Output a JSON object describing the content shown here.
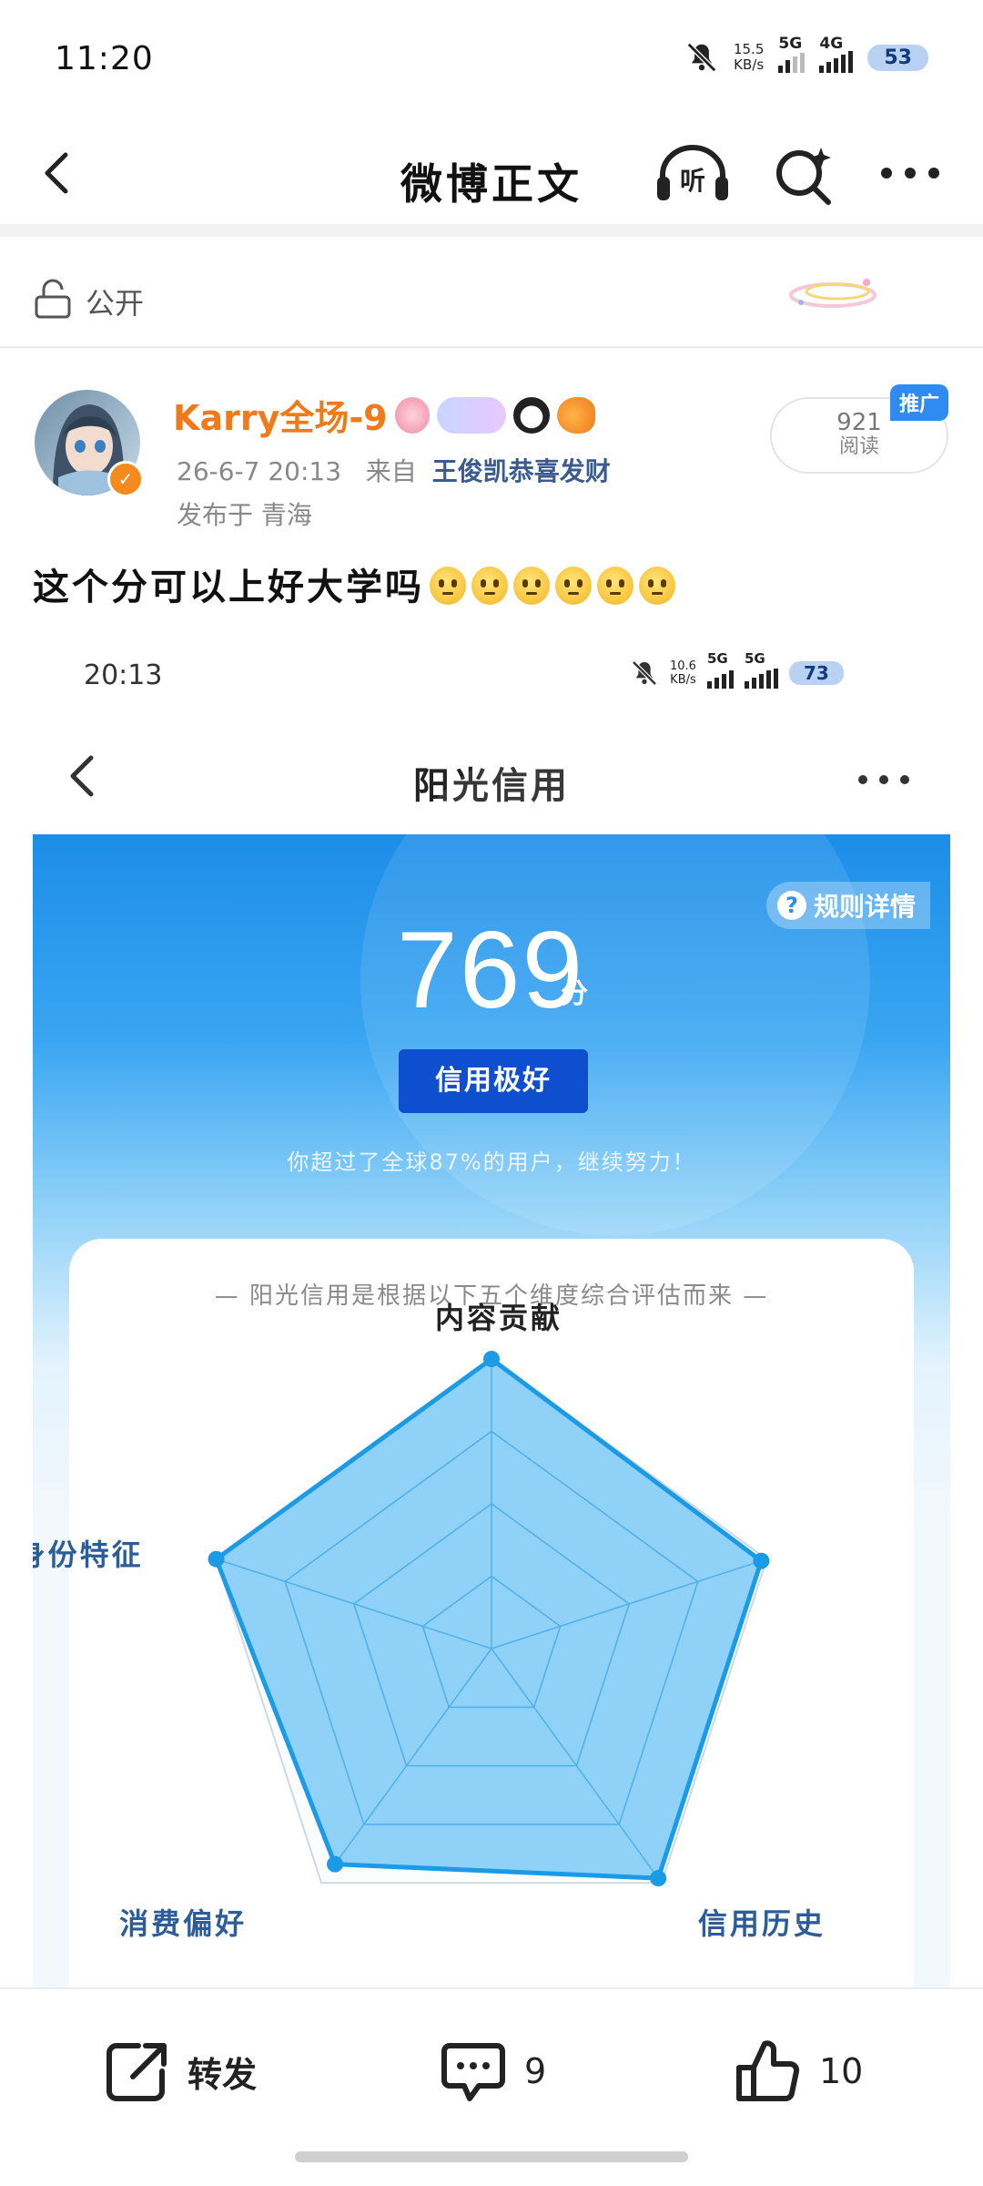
{
  "status_bar": {
    "time": "11:20",
    "net_speed": "15.5",
    "net_unit": "KB/s",
    "sim1": "5G",
    "sim2": "4G",
    "battery": "53"
  },
  "nav": {
    "title": "微博正文",
    "listen_label": "听",
    "back_icon": "chevron-left-icon",
    "search_icon": "ai-search-icon",
    "more_icon": "more-dots-icon"
  },
  "visibility": {
    "label": "公开",
    "icon": "unlock-icon"
  },
  "post": {
    "author": "Karry全场-9",
    "timestamp": "26-6-7 20:13",
    "source_prefix": "来自",
    "source": "王俊凯恭喜发财",
    "location": "发布于 青海",
    "read_count": "921",
    "read_label": "阅读",
    "promo_tag": "推广",
    "text": "这个分可以上好大学吗",
    "emoji_count": 6
  },
  "embedded": {
    "status_time": "20:13",
    "net_speed": "10.6",
    "net_unit": "KB/s",
    "sim1": "5G",
    "sim2": "5G",
    "battery": "73",
    "title": "阳光信用",
    "rules_label": "规则详情",
    "score": "769",
    "score_unit": "分",
    "level": "信用极好",
    "beat_text": "你超过了全球87%的用户，继续努力！",
    "card_desc": "— 阳光信用是根据以下五个维度综合评估而来 —",
    "colors": {
      "hero": "#1c8de8",
      "level_button": "#0e4fcf",
      "radar_fill": "#7ccaf6",
      "radar_stroke": "#1b9be6"
    }
  },
  "chart_data": {
    "type": "radar",
    "categories": [
      "内容贡献",
      "",
      "信用历史",
      "消费偏好",
      "身份特征"
    ],
    "values": [
      1.0,
      0.98,
      0.98,
      0.92,
      1.0
    ],
    "range": [
      0,
      1
    ],
    "rings": 4
  },
  "toolbar": {
    "repost_label": "转发",
    "comment_count": "9",
    "like_count": "10"
  }
}
